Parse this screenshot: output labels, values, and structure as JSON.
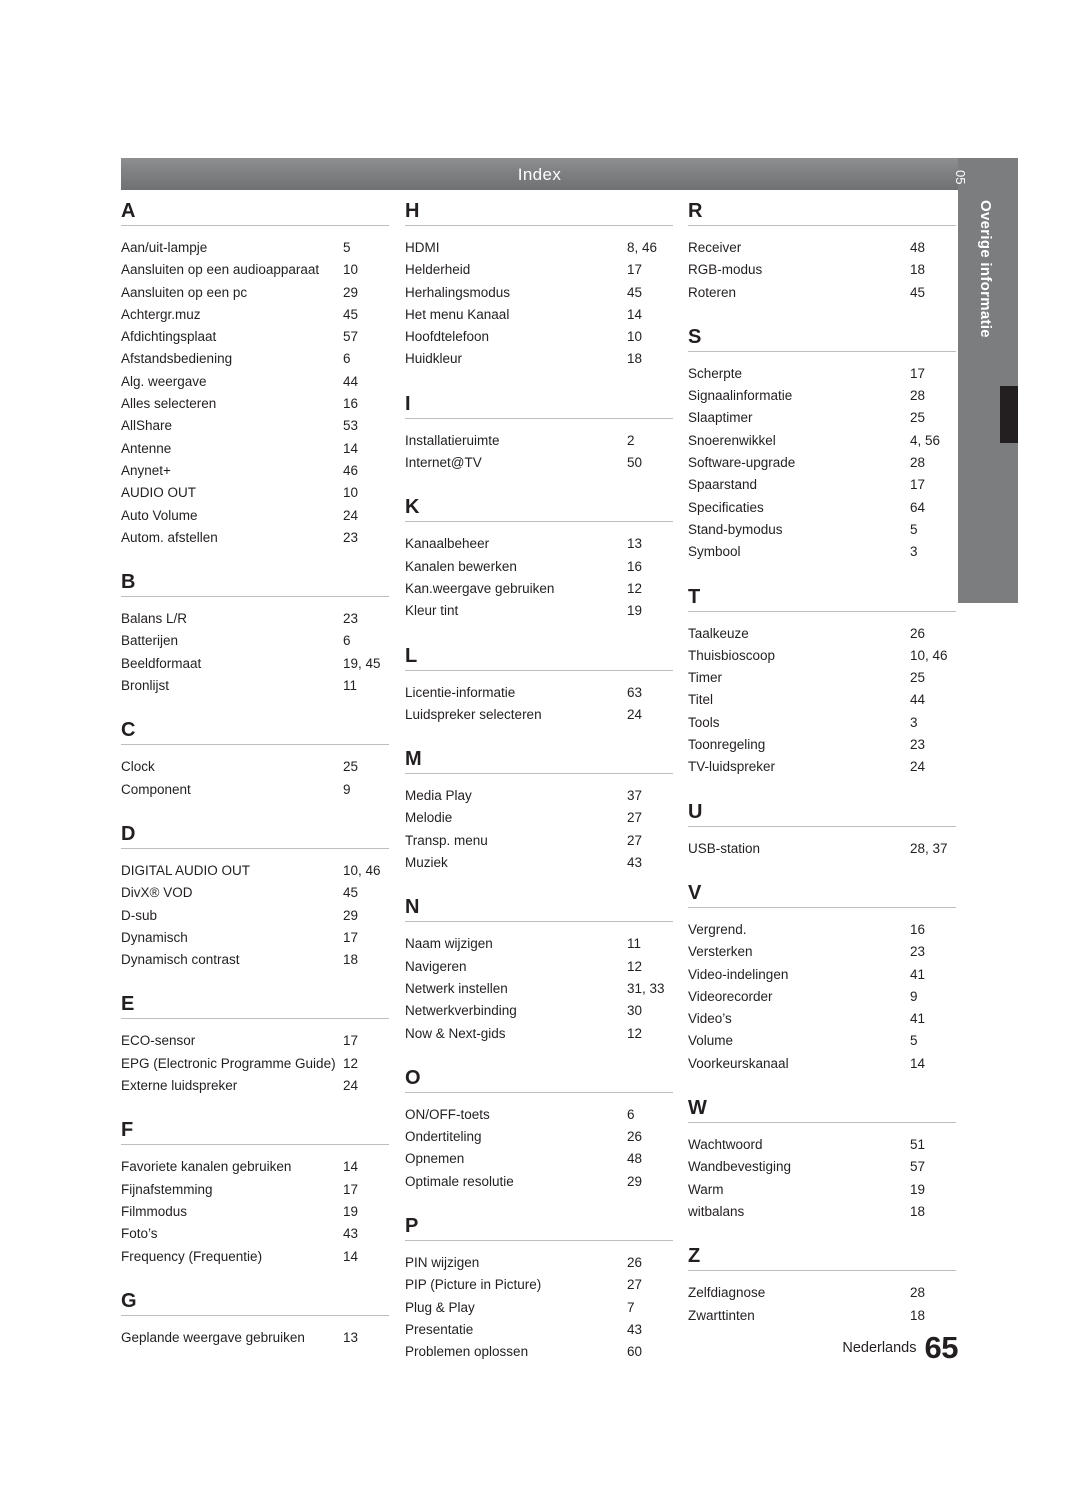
{
  "header": {
    "title": "Index"
  },
  "side_tab": {
    "number": "05",
    "label": "Overige informatie"
  },
  "footer": {
    "language": "Nederlands",
    "page_number": "65"
  },
  "columns": [
    {
      "id": "column-1",
      "blocks": [
        {
          "letter": "A",
          "entries": [
            {
              "term": "Aan/uit-lampje",
              "pages": "5"
            },
            {
              "term": "Aansluiten op een audioapparaat",
              "pages": "10"
            },
            {
              "term": "Aansluiten op een pc",
              "pages": "29"
            },
            {
              "term": "Achtergr.muz",
              "pages": "45"
            },
            {
              "term": "Afdichtingsplaat",
              "pages": "57"
            },
            {
              "term": "Afstandsbediening",
              "pages": "6"
            },
            {
              "term": "Alg. weergave",
              "pages": "44"
            },
            {
              "term": "Alles selecteren",
              "pages": "16"
            },
            {
              "term": "AllShare",
              "pages": "53"
            },
            {
              "term": "Antenne",
              "pages": "14"
            },
            {
              "term": "Anynet+",
              "pages": "46"
            },
            {
              "term": "AUDIO OUT",
              "pages": "10"
            },
            {
              "term": "Auto Volume",
              "pages": "24"
            },
            {
              "term": "Autom. afstellen",
              "pages": "23"
            }
          ]
        },
        {
          "letter": "B",
          "entries": [
            {
              "term": "Balans L/R",
              "pages": "23"
            },
            {
              "term": "Batterijen",
              "pages": "6"
            },
            {
              "term": "Beeldformaat",
              "pages": "19, 45"
            },
            {
              "term": "Bronlijst",
              "pages": "11"
            }
          ]
        },
        {
          "letter": "C",
          "entries": [
            {
              "term": "Clock",
              "pages": "25"
            },
            {
              "term": "Component",
              "pages": "9"
            }
          ]
        },
        {
          "letter": "D",
          "entries": [
            {
              "term": "DIGITAL AUDIO OUT",
              "pages": "10, 46"
            },
            {
              "term": "DivX® VOD",
              "pages": "45"
            },
            {
              "term": "D-sub",
              "pages": "29"
            },
            {
              "term": "Dynamisch",
              "pages": "17"
            },
            {
              "term": "Dynamisch contrast",
              "pages": "18"
            }
          ]
        },
        {
          "letter": "E",
          "entries": [
            {
              "term": "ECO-sensor",
              "pages": "17"
            },
            {
              "term": "EPG (Electronic Programme Guide)",
              "pages": "12"
            },
            {
              "term": "Externe luidspreker",
              "pages": "24"
            }
          ]
        },
        {
          "letter": "F",
          "entries": [
            {
              "term": "Favoriete kanalen gebruiken",
              "pages": "14"
            },
            {
              "term": "Fijnafstemming",
              "pages": "17"
            },
            {
              "term": "Filmmodus",
              "pages": "19"
            },
            {
              "term": "Foto’s",
              "pages": "43"
            },
            {
              "term": "Frequency (Frequentie)",
              "pages": "14"
            }
          ]
        },
        {
          "letter": "G",
          "entries": [
            {
              "term": "Geplande weergave gebruiken",
              "pages": "13"
            }
          ]
        }
      ]
    },
    {
      "id": "column-2",
      "blocks": [
        {
          "letter": "H",
          "entries": [
            {
              "term": "HDMI",
              "pages": "8, 46"
            },
            {
              "term": "Helderheid",
              "pages": "17"
            },
            {
              "term": "Herhalingsmodus",
              "pages": "45"
            },
            {
              "term": "Het menu Kanaal",
              "pages": "14"
            },
            {
              "term": "Hoofdtelefoon",
              "pages": "10"
            },
            {
              "term": "Huidkleur",
              "pages": "18"
            }
          ]
        },
        {
          "letter": "I",
          "entries": [
            {
              "term": "Installatieruimte",
              "pages": "2"
            },
            {
              "term": "Internet@TV",
              "pages": "50"
            }
          ]
        },
        {
          "letter": "K",
          "entries": [
            {
              "term": "Kanaalbeheer",
              "pages": "13"
            },
            {
              "term": "Kanalen bewerken",
              "pages": "16"
            },
            {
              "term": "Kan.weergave gebruiken",
              "pages": "12"
            },
            {
              "term": "Kleur tint",
              "pages": "19"
            }
          ]
        },
        {
          "letter": "L",
          "entries": [
            {
              "term": "Licentie-informatie",
              "pages": "63"
            },
            {
              "term": "Luidspreker selecteren",
              "pages": "24"
            }
          ]
        },
        {
          "letter": "M",
          "entries": [
            {
              "term": "Media Play",
              "pages": "37"
            },
            {
              "term": "Melodie",
              "pages": "27"
            },
            {
              "term": "Transp. menu",
              "pages": "27"
            },
            {
              "term": "Muziek",
              "pages": "43"
            }
          ]
        },
        {
          "letter": "N",
          "entries": [
            {
              "term": "Naam wijzigen",
              "pages": "11"
            },
            {
              "term": "Navigeren",
              "pages": "12"
            },
            {
              "term": "Netwerk instellen",
              "pages": "31, 33"
            },
            {
              "term": "Netwerkverbinding",
              "pages": "30"
            },
            {
              "term": "Now & Next-gids",
              "pages": "12"
            }
          ]
        },
        {
          "letter": "O",
          "entries": [
            {
              "term": "ON/OFF-toets",
              "pages": "6"
            },
            {
              "term": "Ondertiteling",
              "pages": "26"
            },
            {
              "term": "Opnemen",
              "pages": "48"
            },
            {
              "term": "Optimale resolutie",
              "pages": "29"
            }
          ]
        },
        {
          "letter": "P",
          "entries": [
            {
              "term": "PIN wijzigen",
              "pages": "26"
            },
            {
              "term": "PIP (Picture in Picture)",
              "pages": "27"
            },
            {
              "term": "Plug & Play",
              "pages": "7"
            },
            {
              "term": "Presentatie",
              "pages": "43"
            },
            {
              "term": "Problemen oplossen",
              "pages": "60"
            }
          ]
        }
      ]
    },
    {
      "id": "column-3",
      "blocks": [
        {
          "letter": "R",
          "entries": [
            {
              "term": "Receiver",
              "pages": "48"
            },
            {
              "term": "RGB-modus",
              "pages": "18"
            },
            {
              "term": "Roteren",
              "pages": "45"
            }
          ]
        },
        {
          "letter": "S",
          "entries": [
            {
              "term": "Scherpte",
              "pages": "17"
            },
            {
              "term": "Signaalinformatie",
              "pages": "28"
            },
            {
              "term": "Slaaptimer",
              "pages": "25"
            },
            {
              "term": "Snoerenwikkel",
              "pages": "4, 56"
            },
            {
              "term": "Software-upgrade",
              "pages": "28"
            },
            {
              "term": "Spaarstand",
              "pages": "17"
            },
            {
              "term": "Specificaties",
              "pages": "64"
            },
            {
              "term": "Stand-bymodus",
              "pages": "5"
            },
            {
              "term": "Symbool",
              "pages": "3"
            }
          ]
        },
        {
          "letter": "T",
          "entries": [
            {
              "term": "Taalkeuze",
              "pages": "26"
            },
            {
              "term": "Thuisbioscoop",
              "pages": "10, 46"
            },
            {
              "term": "Timer",
              "pages": "25"
            },
            {
              "term": "Titel",
              "pages": "44"
            },
            {
              "term": "Tools",
              "pages": "3"
            },
            {
              "term": "Toonregeling",
              "pages": "23"
            },
            {
              "term": "TV-luidspreker",
              "pages": "24"
            }
          ]
        },
        {
          "letter": "U",
          "entries": [
            {
              "term": "USB-station",
              "pages": "28, 37"
            }
          ]
        },
        {
          "letter": "V",
          "entries": [
            {
              "term": "Vergrend.",
              "pages": "16"
            },
            {
              "term": "Versterken",
              "pages": "23"
            },
            {
              "term": "Video-indelingen",
              "pages": "41"
            },
            {
              "term": "Videorecorder",
              "pages": "9"
            },
            {
              "term": "Video’s",
              "pages": "41"
            },
            {
              "term": "Volume",
              "pages": "5"
            },
            {
              "term": "Voorkeurskanaal",
              "pages": "14"
            }
          ]
        },
        {
          "letter": "W",
          "entries": [
            {
              "term": "Wachtwoord",
              "pages": "51"
            },
            {
              "term": "Wandbevestiging",
              "pages": "57"
            },
            {
              "term": "Warm",
              "pages": "19"
            },
            {
              "term": "witbalans",
              "pages": "18"
            }
          ]
        },
        {
          "letter": "Z",
          "entries": [
            {
              "term": "Zelfdiagnose",
              "pages": "28"
            },
            {
              "term": "Zwarttinten",
              "pages": "18"
            }
          ]
        }
      ]
    }
  ]
}
